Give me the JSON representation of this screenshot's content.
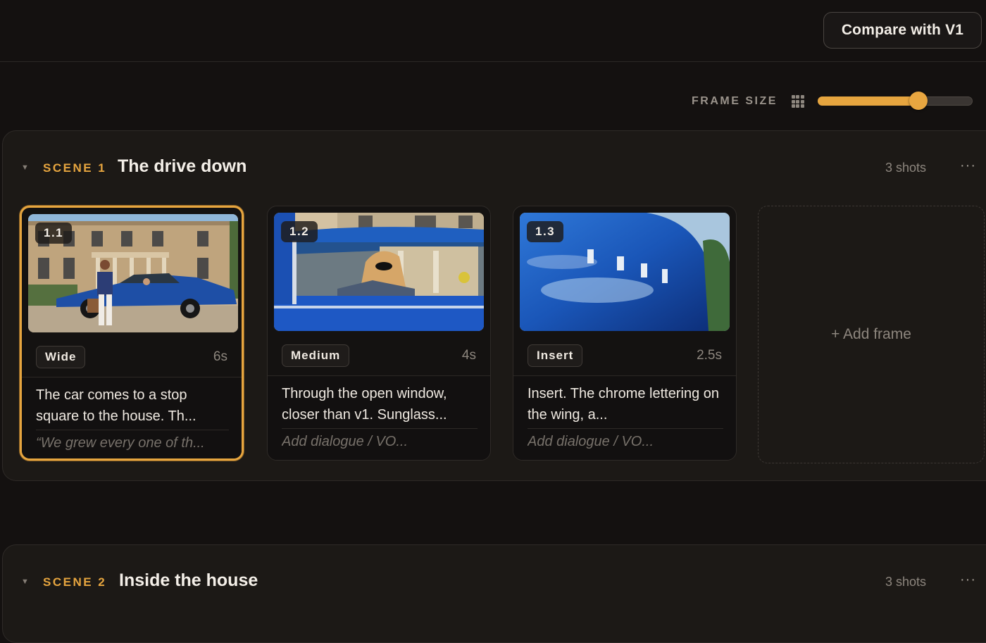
{
  "header": {
    "compare_label": "Compare with V1"
  },
  "toolbar": {
    "frame_size_label": "FRAME SIZE",
    "frame_size_icon": "grid-icon",
    "frame_size_value": 0.65
  },
  "colors": {
    "accent": "#e6a53f",
    "background": "#141110",
    "panel": "#1c1916"
  },
  "scenes": [
    {
      "label": "SCENE 1",
      "title": "The drive down",
      "count": "3 shots",
      "more": "···",
      "add_frame_label": "+ Add frame",
      "shots": [
        {
          "number": "1.1",
          "type": "Wide",
          "duration": "6s",
          "description": "The car comes to a stop square to the house. Th...",
          "dialogue": "“We grew every one of th...",
          "selected": true
        },
        {
          "number": "1.2",
          "type": "Medium",
          "duration": "4s",
          "description": "Through the open window, closer than v1. Sunglass...",
          "dialogue": "Add dialogue / VO...",
          "selected": false
        },
        {
          "number": "1.3",
          "type": "Insert",
          "duration": "2.5s",
          "description": "Insert. The chrome lettering on the wing, a...",
          "dialogue": "Add dialogue / VO...",
          "selected": false
        }
      ]
    },
    {
      "label": "SCENE 2",
      "title": "Inside the house",
      "count": "3 shots",
      "more": "···"
    }
  ]
}
